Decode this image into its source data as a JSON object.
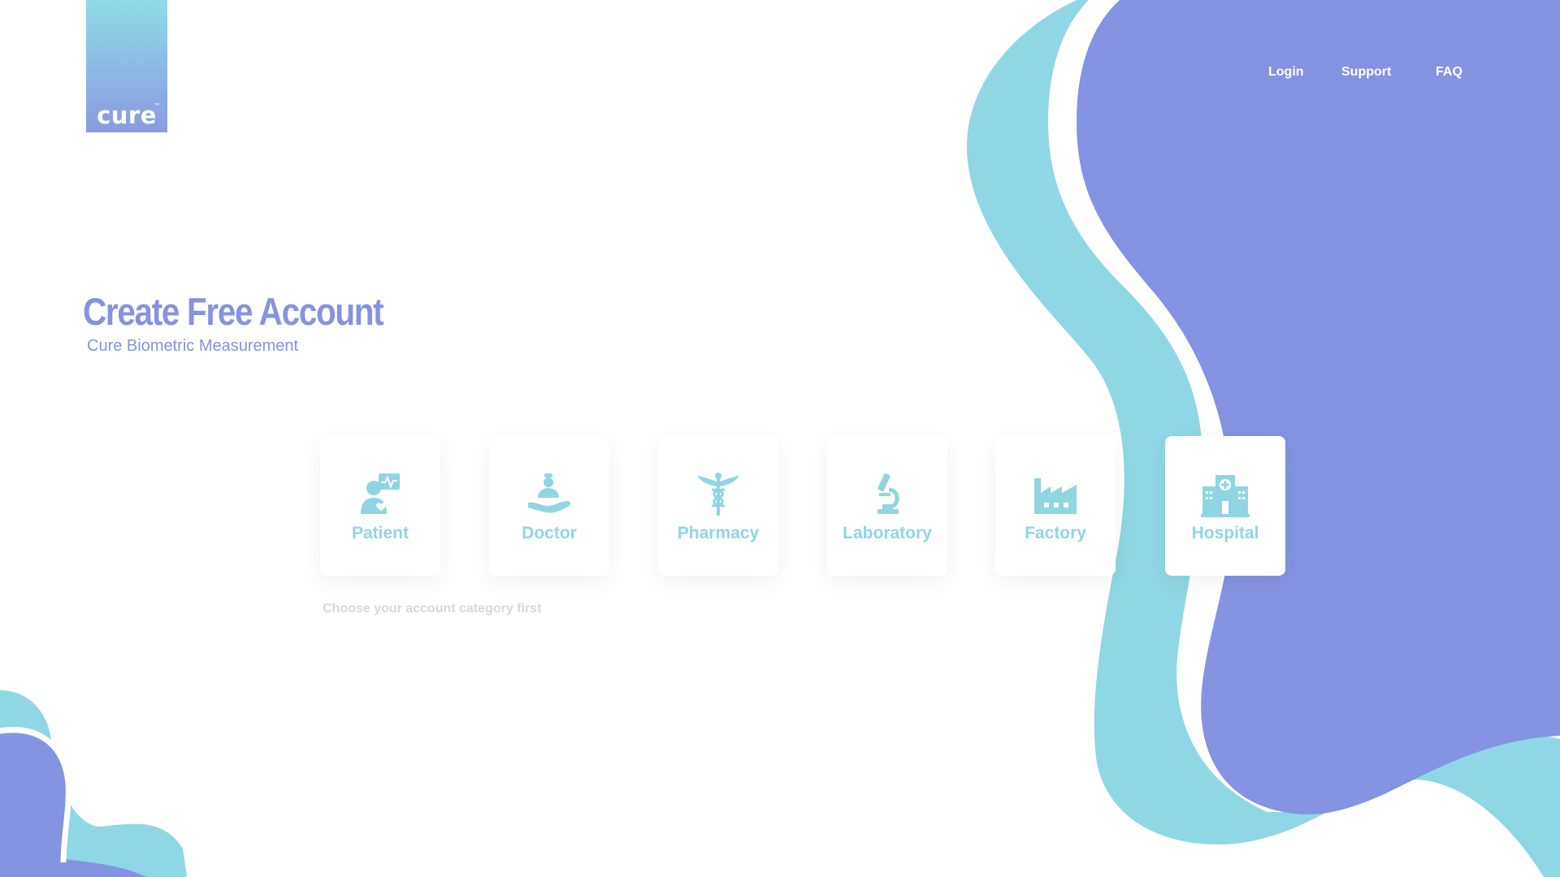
{
  "brand": {
    "logo_text": "cure",
    "trademark": "™"
  },
  "nav": {
    "login": "Login",
    "support": "Support",
    "faq": "FAQ"
  },
  "hero": {
    "title": "Create Free Account",
    "subtitle": "Cure Biometric Measurement"
  },
  "categories": [
    {
      "label": "Patient",
      "icon": "patient-heart-monitor-icon"
    },
    {
      "label": "Doctor",
      "icon": "doctor-care-hand-icon"
    },
    {
      "label": "Pharmacy",
      "icon": "caduceus-icon"
    },
    {
      "label": "Laboratory",
      "icon": "microscope-icon"
    },
    {
      "label": "Factory",
      "icon": "factory-icon"
    },
    {
      "label": "Hospital",
      "icon": "hospital-building-icon",
      "selected": true
    }
  ],
  "hint": "Choose your account category first",
  "colors": {
    "primary": "#8593e0",
    "accent": "#8fd6e2",
    "blob_purple": "#8493e2",
    "blob_cyan": "#8fd7e5"
  }
}
